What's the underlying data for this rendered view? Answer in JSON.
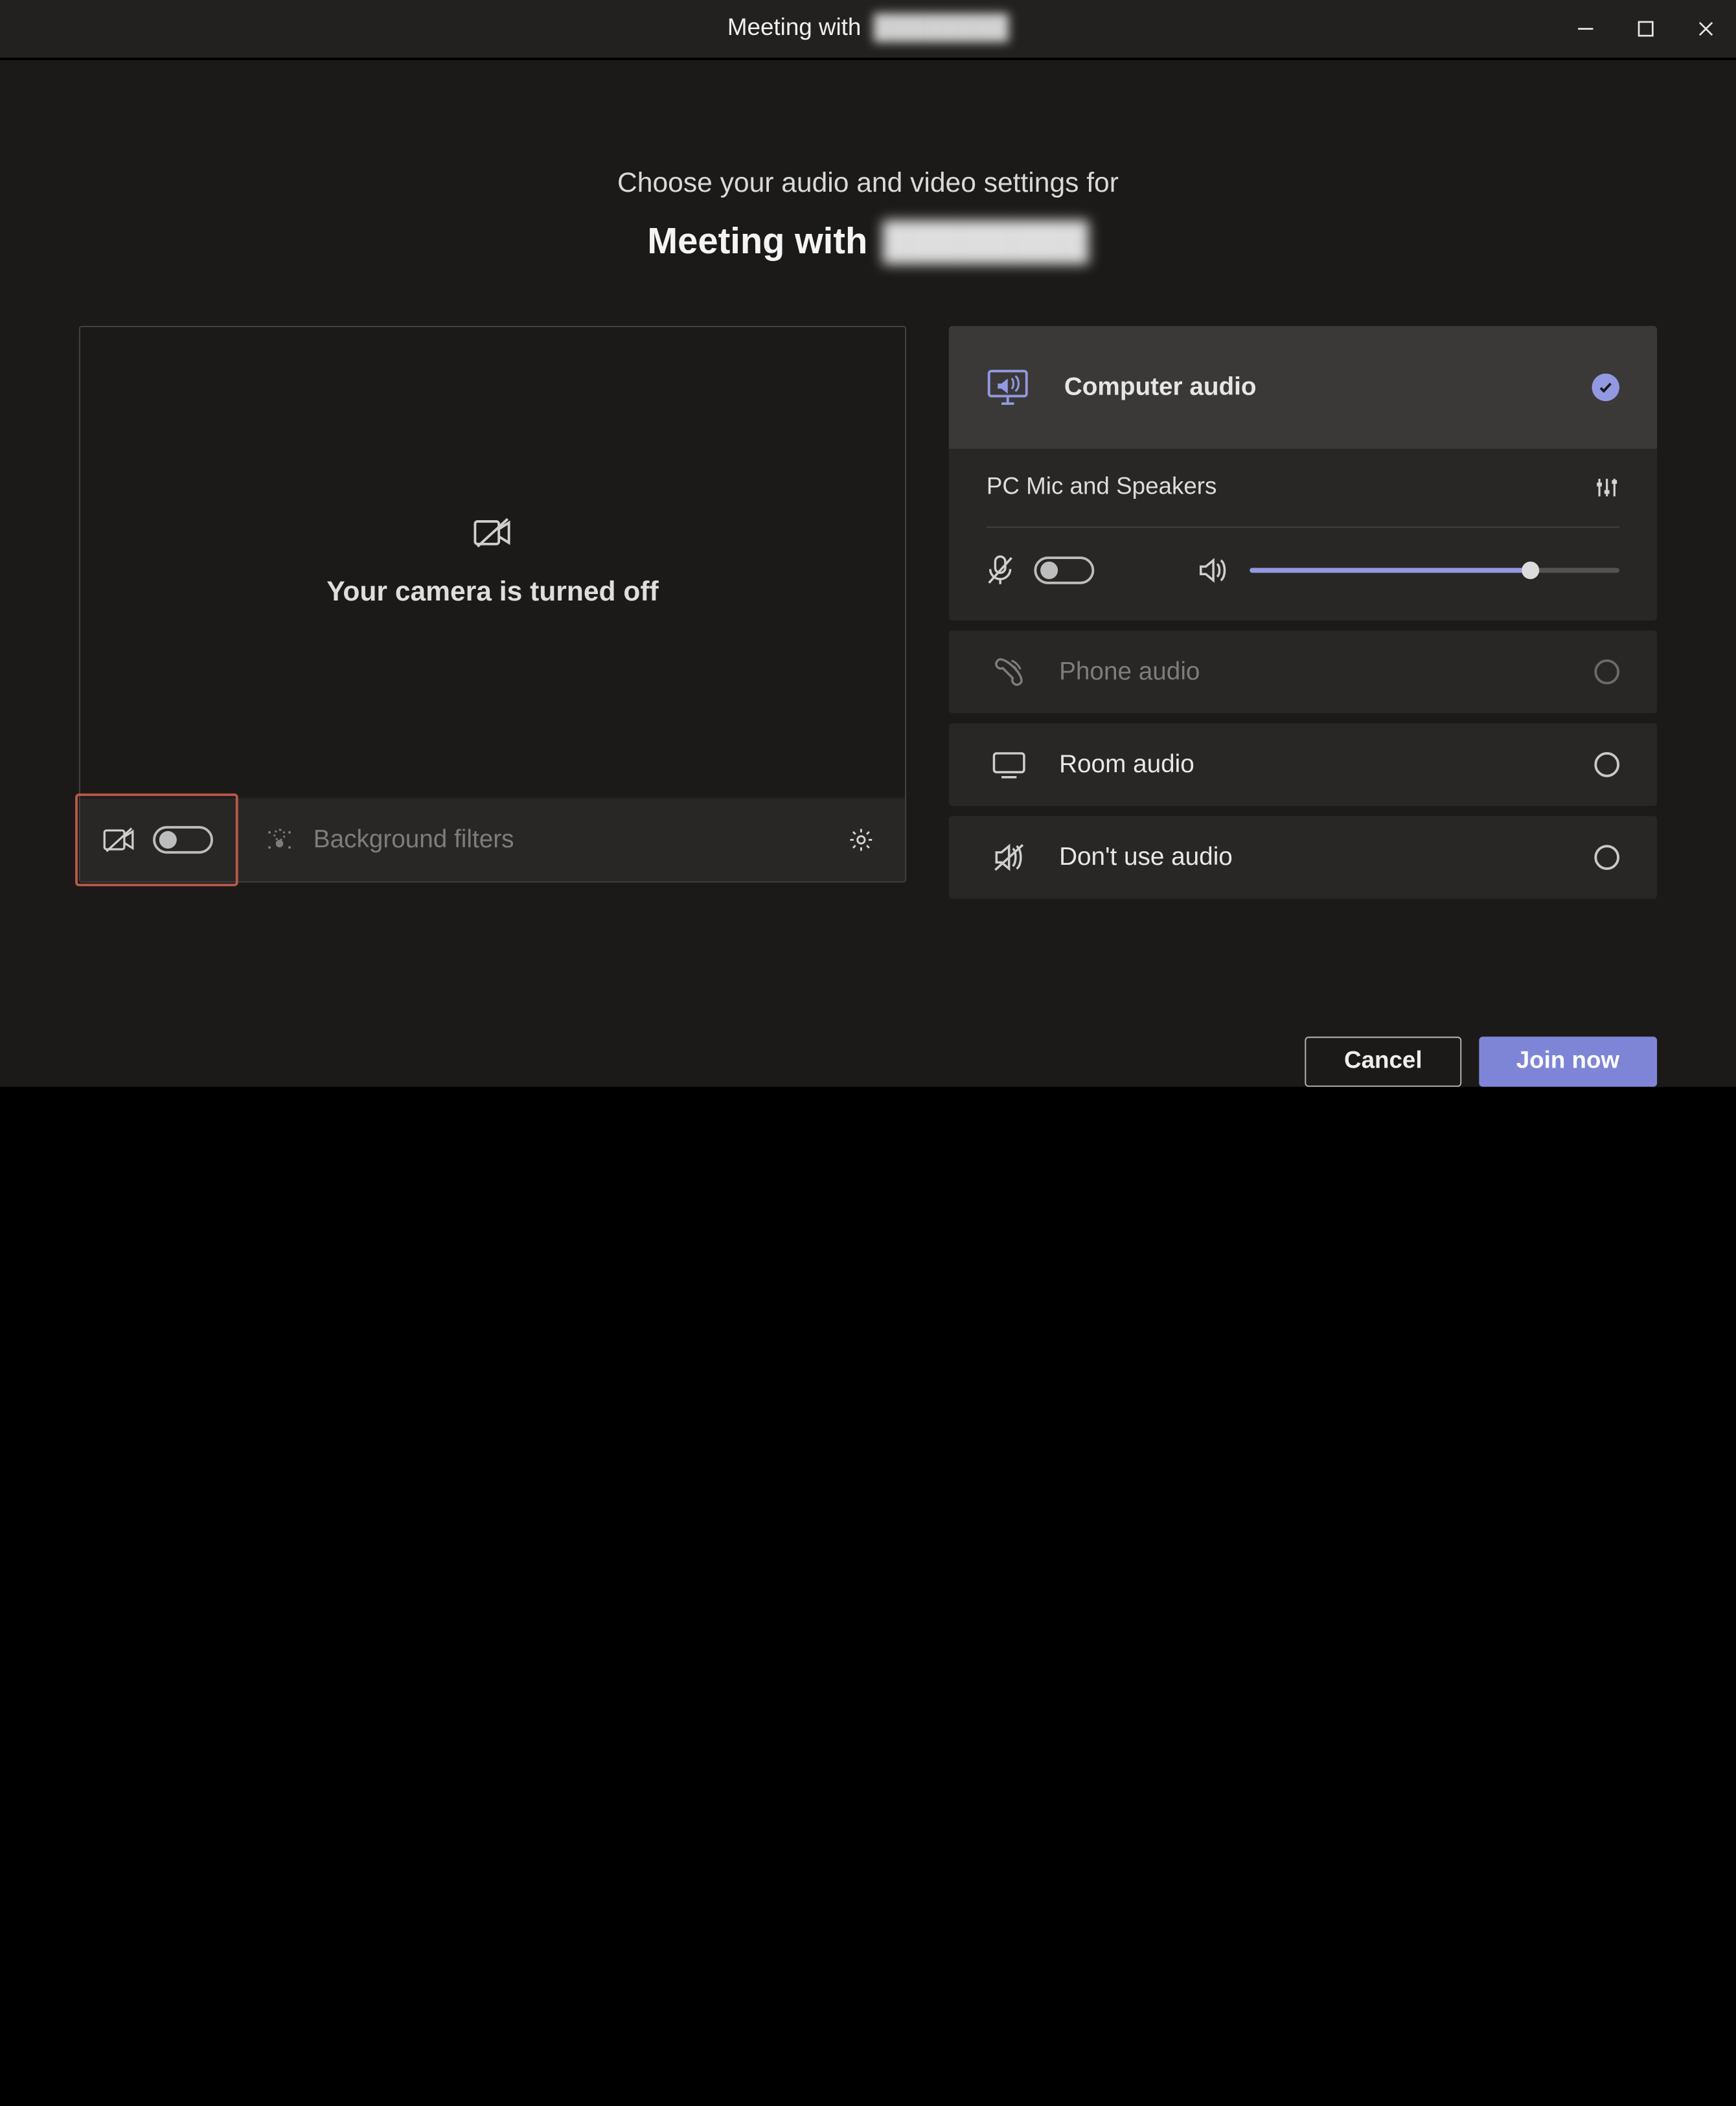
{
  "titlebar": {
    "prefix": "Meeting with",
    "name_blurred": "████████"
  },
  "headline": {
    "line1": "Choose your audio and video settings for",
    "line2_prefix": "Meeting with",
    "line2_name_blurred": "████████"
  },
  "video": {
    "camera_off_msg": "Your camera is turned off",
    "background_filters_label": "Background filters"
  },
  "audio": {
    "computer_audio": {
      "label": "Computer audio",
      "selected": true
    },
    "device_row": {
      "label": "PC Mic and Speakers"
    },
    "mic_on": false,
    "volume_percent": 76,
    "phone_audio": {
      "label": "Phone audio",
      "enabled": false
    },
    "room_audio": {
      "label": "Room audio"
    },
    "dont_use_audio": {
      "label": "Don't use audio"
    }
  },
  "footer": {
    "cancel": "Cancel",
    "join": "Join now"
  },
  "icons": {
    "camera_off": "camera-off-icon",
    "bg_filters": "bg-blur-icon",
    "gear": "gear-icon",
    "computer_audio": "pc-audio-icon",
    "settings_sliders": "sliders-icon",
    "mic_off": "mic-off-icon",
    "speaker": "speaker-icon",
    "phone": "phone-icon",
    "tv": "tv-icon",
    "speaker_off": "speaker-off-icon"
  },
  "colors": {
    "accent": "#7f85d6",
    "highlight_box": "#bb5847"
  }
}
